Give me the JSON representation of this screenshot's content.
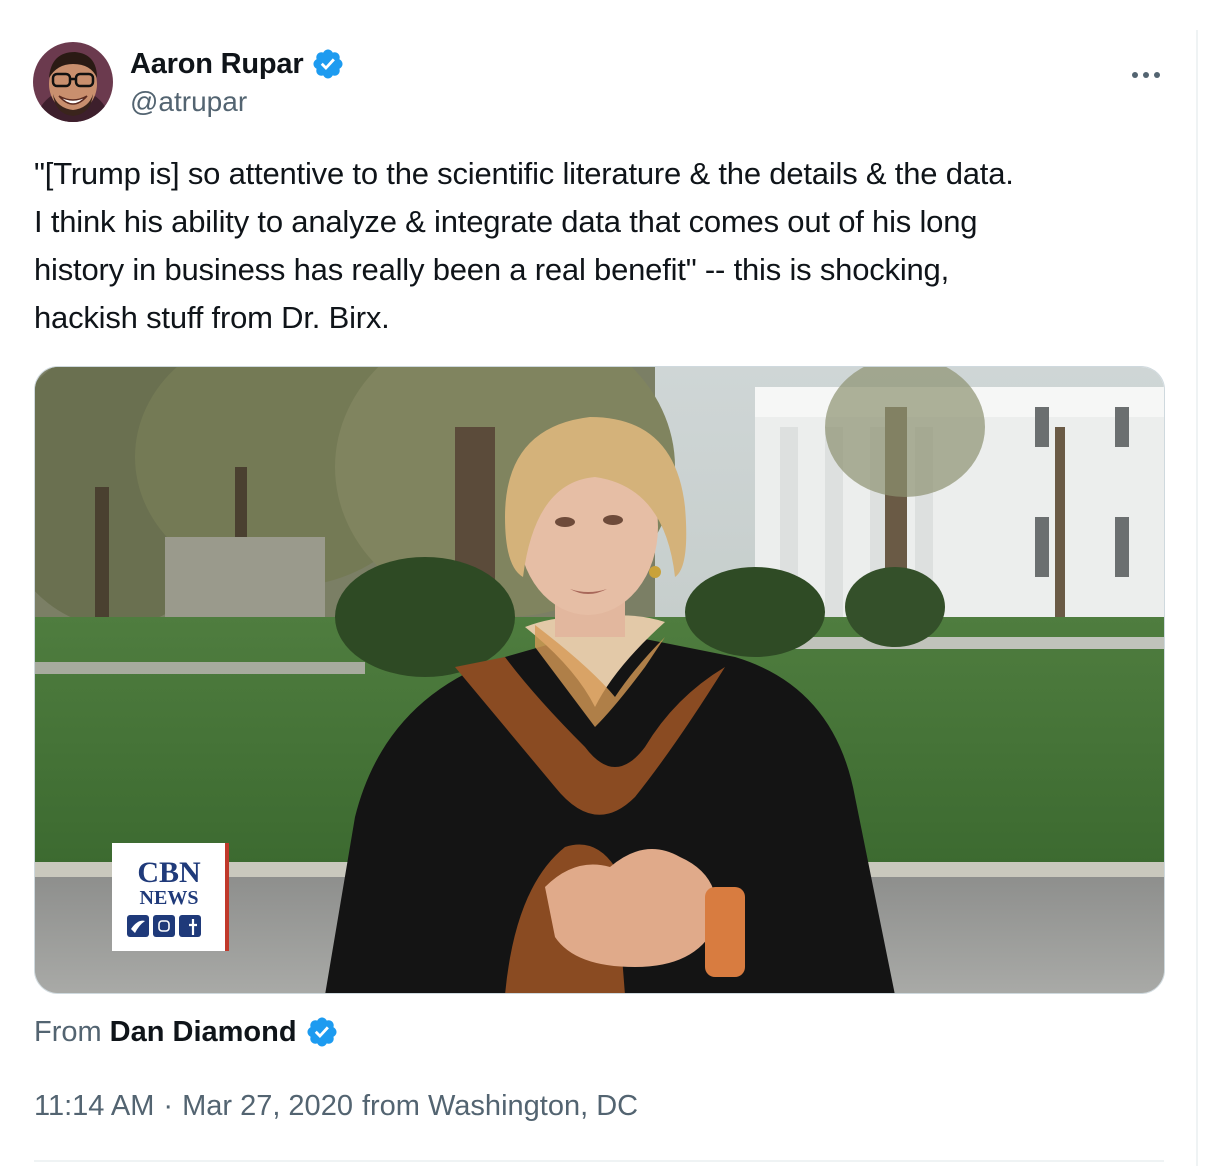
{
  "author": {
    "display_name": "Aaron Rupar",
    "handle": "@atrupar",
    "verified_icon": "verified-badge-icon"
  },
  "more_icon": "more-options-icon",
  "tweet": {
    "lines": [
      "\"[Trump is] so attentive to the scientific literature & the details & the data.",
      "I think his ability to analyze & integrate data that comes out of his long",
      "history in business has really been a real benefit\" -- this is shocking,",
      "hackish stuff from Dr. Birx."
    ]
  },
  "media": {
    "logo_line1": "CBN",
    "logo_line2": "NEWS"
  },
  "source": {
    "from_label": "From",
    "from_name": "Dan Diamond"
  },
  "meta": {
    "time": "11:14 AM",
    "separator": "·",
    "date": "Mar 27, 2020",
    "location": "from Washington, DC"
  },
  "colors": {
    "verified_blue": "#1d9bf0",
    "secondary_text": "#536471",
    "primary_text": "#0f1419"
  }
}
